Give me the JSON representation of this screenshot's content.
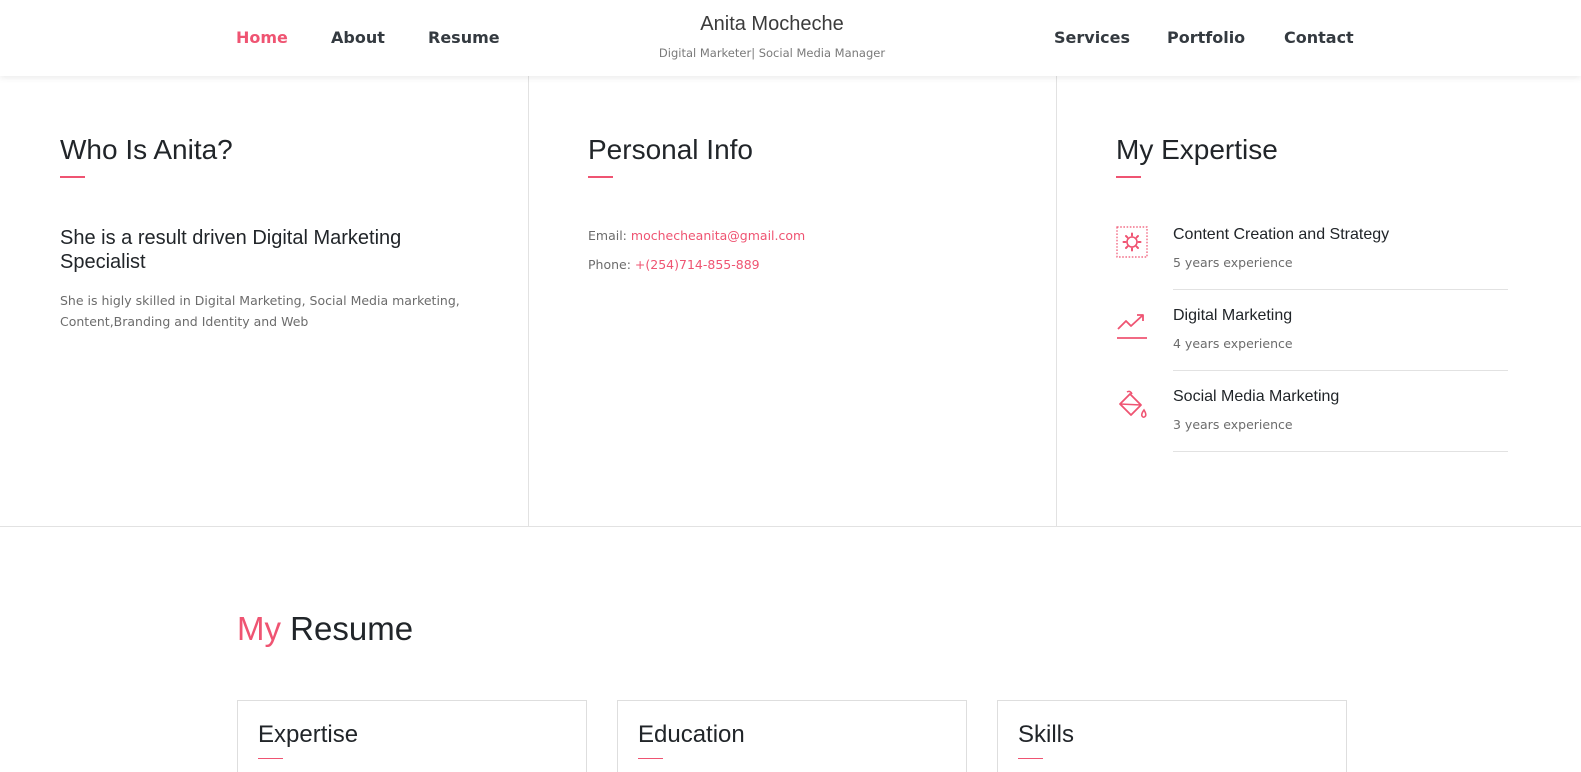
{
  "header": {
    "brand_name": "Anita Mocheche",
    "brand_tagline": "Digital Marketer| Social Media Manager",
    "nav_left": [
      {
        "label": "Home",
        "active": true
      },
      {
        "label": "About",
        "active": false
      },
      {
        "label": "Resume",
        "active": false
      }
    ],
    "nav_right": [
      {
        "label": "Services",
        "active": false
      },
      {
        "label": "Portfolio",
        "active": false
      },
      {
        "label": "Contact",
        "active": false
      }
    ]
  },
  "about": {
    "title": "Who Is Anita?",
    "lead": "She is a result driven Digital Marketing Specialist",
    "body": "She is higly skilled in Digital Marketing, Social Media marketing, Content,Branding and Identity and Web"
  },
  "personal_info": {
    "title": "Personal Info",
    "email_label": "Email:",
    "email_value": "mochecheanita@gmail.com",
    "phone_label": "Phone:",
    "phone_value": "+(254)714-855-889"
  },
  "expertise": {
    "title": "My Expertise",
    "items": [
      {
        "name": "Content Creation and Strategy",
        "years": "5 years experience",
        "icon": "gear-icon"
      },
      {
        "name": "Digital Marketing",
        "years": "4 years experience",
        "icon": "trend-chart-icon"
      },
      {
        "name": "Social Media Marketing",
        "years": "3 years experience",
        "icon": "paint-bucket-icon"
      }
    ]
  },
  "resume": {
    "title_accent": "My",
    "title_rest": "Resume",
    "cards": [
      {
        "title": "Expertise"
      },
      {
        "title": "Education"
      },
      {
        "title": "Skills"
      }
    ]
  },
  "colors": {
    "accent": "#ef5472",
    "text": "#212529",
    "muted": "#6c6c6c",
    "border": "#e2e2e2"
  }
}
